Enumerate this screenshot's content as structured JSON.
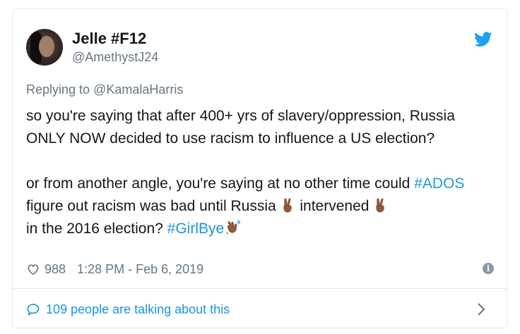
{
  "user": {
    "display_name": "Jelle #F12",
    "handle": "@AmethystJ24"
  },
  "tweet": {
    "replying_prefix": "Replying to",
    "replying_to": "@KamalaHarris",
    "p1": "so you're saying that after 400+ yrs of slavery/oppression, Russia ONLY NOW decided to use racism to influence a US election?",
    "p2_a": "or from another angle, you're saying at no other time could",
    "p2_tag1": "#ADOS",
    "p2_b": "figure out racism was bad until Russia",
    "p2_c": "intervened",
    "p2_d": "in the 2016 election?",
    "p2_tag2": "#GirlBye"
  },
  "meta": {
    "likes": "988",
    "timestamp": "1:28 PM - Feb 6, 2019"
  },
  "footer": {
    "talking": "109 people are talking about this"
  },
  "colors": {
    "link": "#1b95e0",
    "muted": "#657786",
    "text": "#14171a",
    "border": "#e1e8ed"
  },
  "icons": [
    "twitter-bird-icon",
    "heart-icon",
    "info-icon",
    "speech-bubble-icon",
    "chevron-right-icon",
    "victory-hand-emoji",
    "waving-hand-emoji"
  ]
}
